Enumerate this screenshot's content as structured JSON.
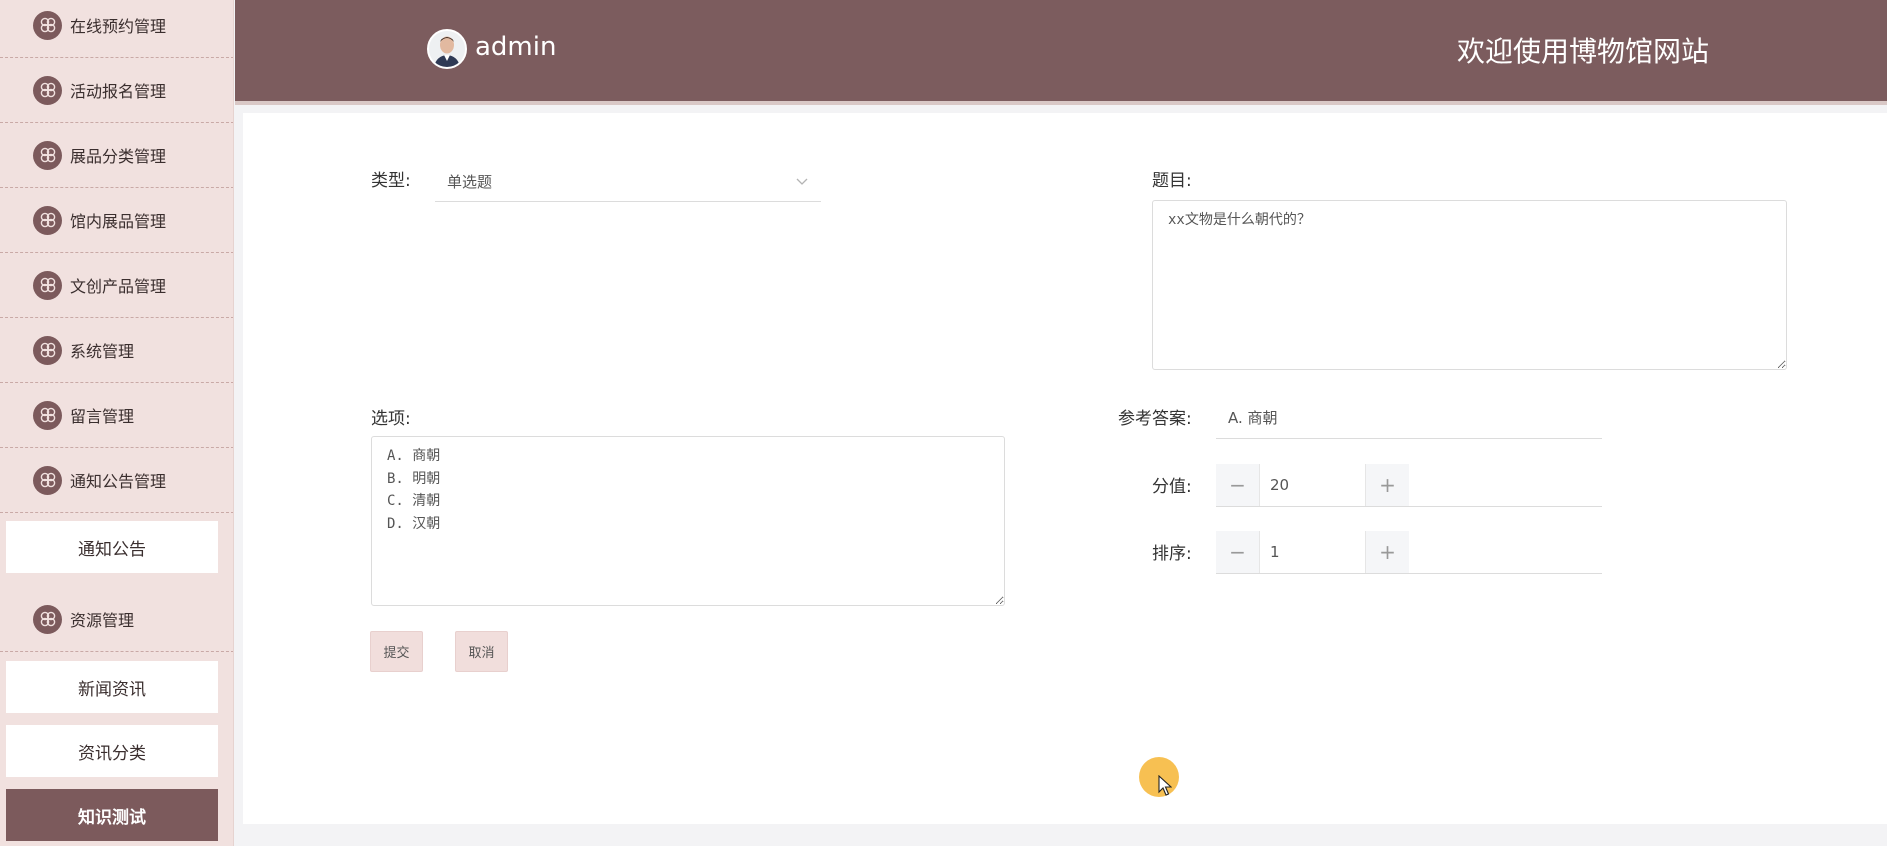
{
  "sidebar": {
    "groups": [
      {
        "label": "在线预约管理",
        "icon": "flower-icon"
      },
      {
        "label": "活动报名管理",
        "icon": "flower-icon"
      },
      {
        "label": "展品分类管理",
        "icon": "flower-icon"
      },
      {
        "label": "馆内展品管理",
        "icon": "flower-icon"
      },
      {
        "label": "文创产品管理",
        "icon": "flower-icon"
      },
      {
        "label": "系统管理",
        "icon": "flower-icon"
      },
      {
        "label": "留言管理",
        "icon": "flower-icon"
      },
      {
        "label": "通知公告管理",
        "icon": "flower-icon"
      },
      {
        "label": "资源管理",
        "icon": "flower-icon"
      }
    ],
    "subitems": {
      "notice": "通知公告",
      "news": "新闻资讯",
      "news_category": "资讯分类",
      "quiz": "知识测试"
    },
    "active_item": "知识测试"
  },
  "header": {
    "username": "admin",
    "avatar": "user-avatar",
    "site_title": "欢迎使用博物馆网站"
  },
  "form": {
    "type_label": "类型:",
    "type_value": "单选题",
    "question_label": "题目:",
    "question_value": "xx文物是什么朝代的？",
    "options_label": "选项:",
    "options_value": "A. 商朝\nB. 明朝\nC. 清朝\nD. 汉朝",
    "answer_label": "参考答案:",
    "answer_value": "A. 商朝",
    "score_label": "分值:",
    "score_value": "20",
    "order_label": "排序:",
    "order_value": "1",
    "submit_label": "提交",
    "cancel_label": "取消"
  },
  "colors": {
    "brand": "#7c5c5e",
    "sidebar_bg": "#f1e1df",
    "button_bg": "#f1dedc"
  }
}
